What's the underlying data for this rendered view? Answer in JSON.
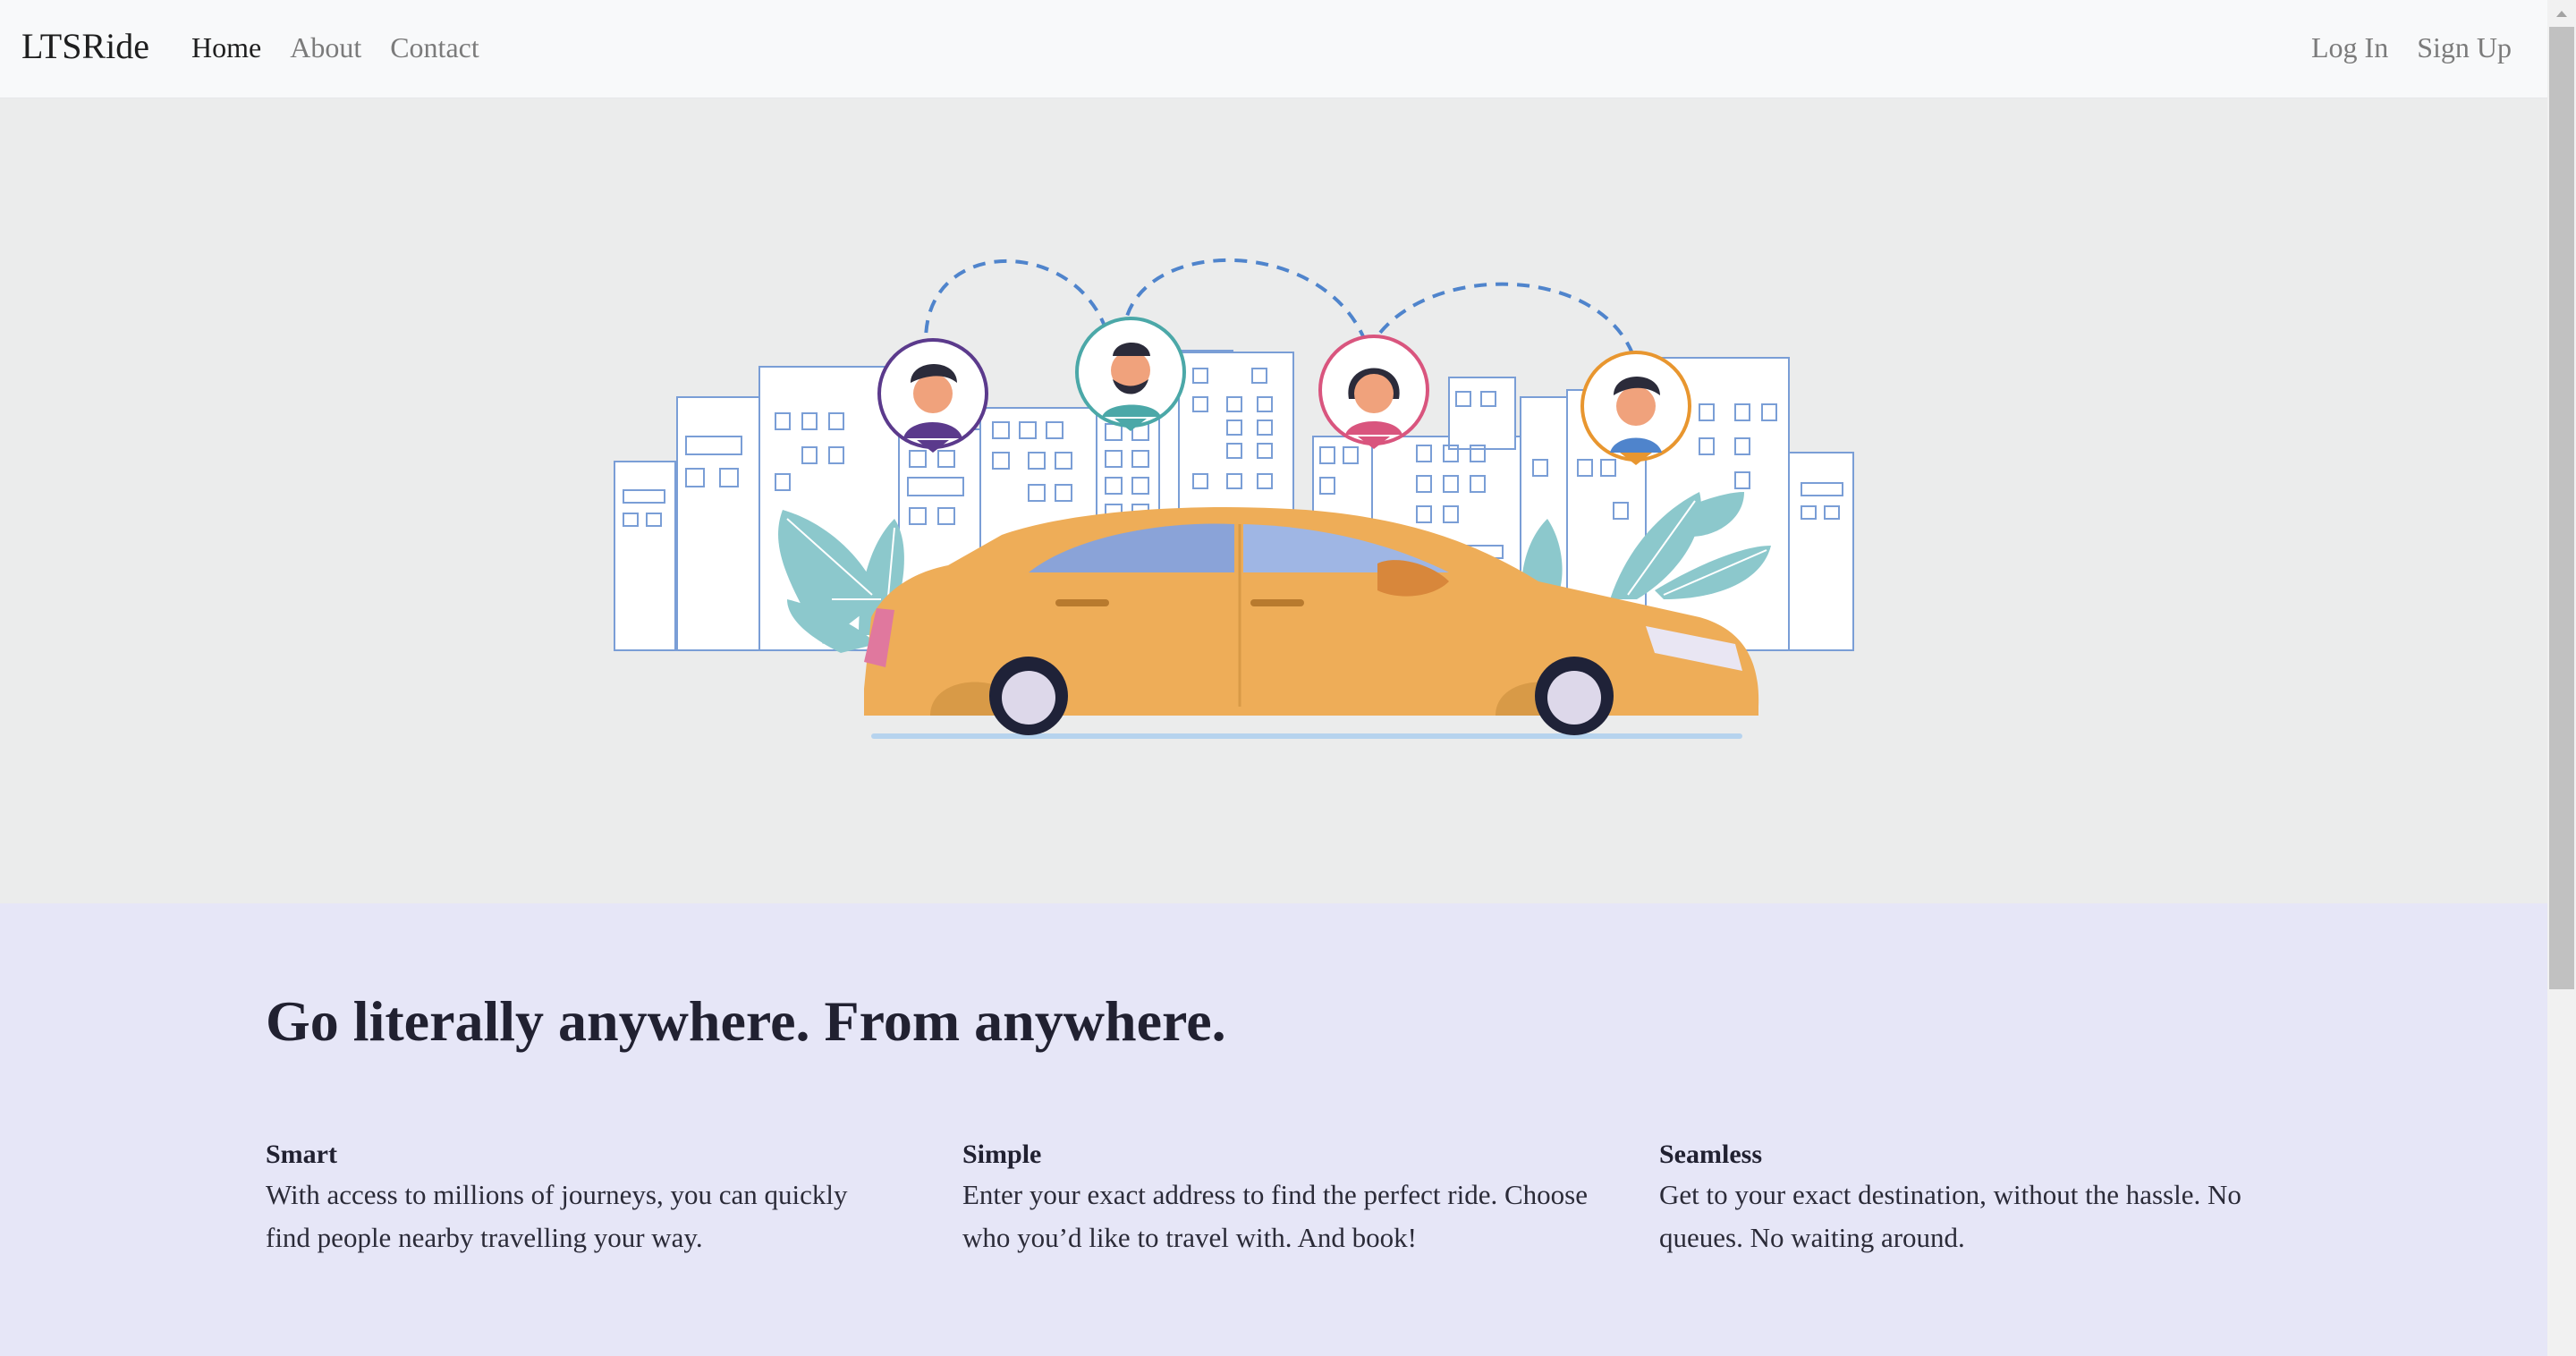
{
  "navbar": {
    "brand": "LTSRide",
    "links": [
      {
        "label": "Home",
        "active": true
      },
      {
        "label": "About",
        "active": false
      },
      {
        "label": "Contact",
        "active": false
      }
    ],
    "auth": [
      {
        "label": "Log In"
      },
      {
        "label": "Sign Up"
      }
    ]
  },
  "hero": {
    "illustration": "city-taxi-illustration",
    "colors": {
      "background": "#ebecec",
      "car": "#eead58",
      "building_outline": "#7a9ed6",
      "leaf": "#8cc8cc",
      "route_line": "#4f84cc"
    }
  },
  "features": {
    "headline": "Go literally anywhere. From anywhere.",
    "items": [
      {
        "title": "Smart",
        "text": "With access to millions of journeys, you can quickly find people nearby travelling your way."
      },
      {
        "title": "Simple",
        "text": "Enter your exact address to find the perfect ride. Choose who you’d like to travel with. And book!"
      },
      {
        "title": "Seamless",
        "text": "Get to your exact destination, without the hassle. No queues. No waiting around."
      }
    ],
    "background": "#e6e6f7"
  },
  "scrollbar": {
    "up_icon": "chevron-up-icon"
  }
}
